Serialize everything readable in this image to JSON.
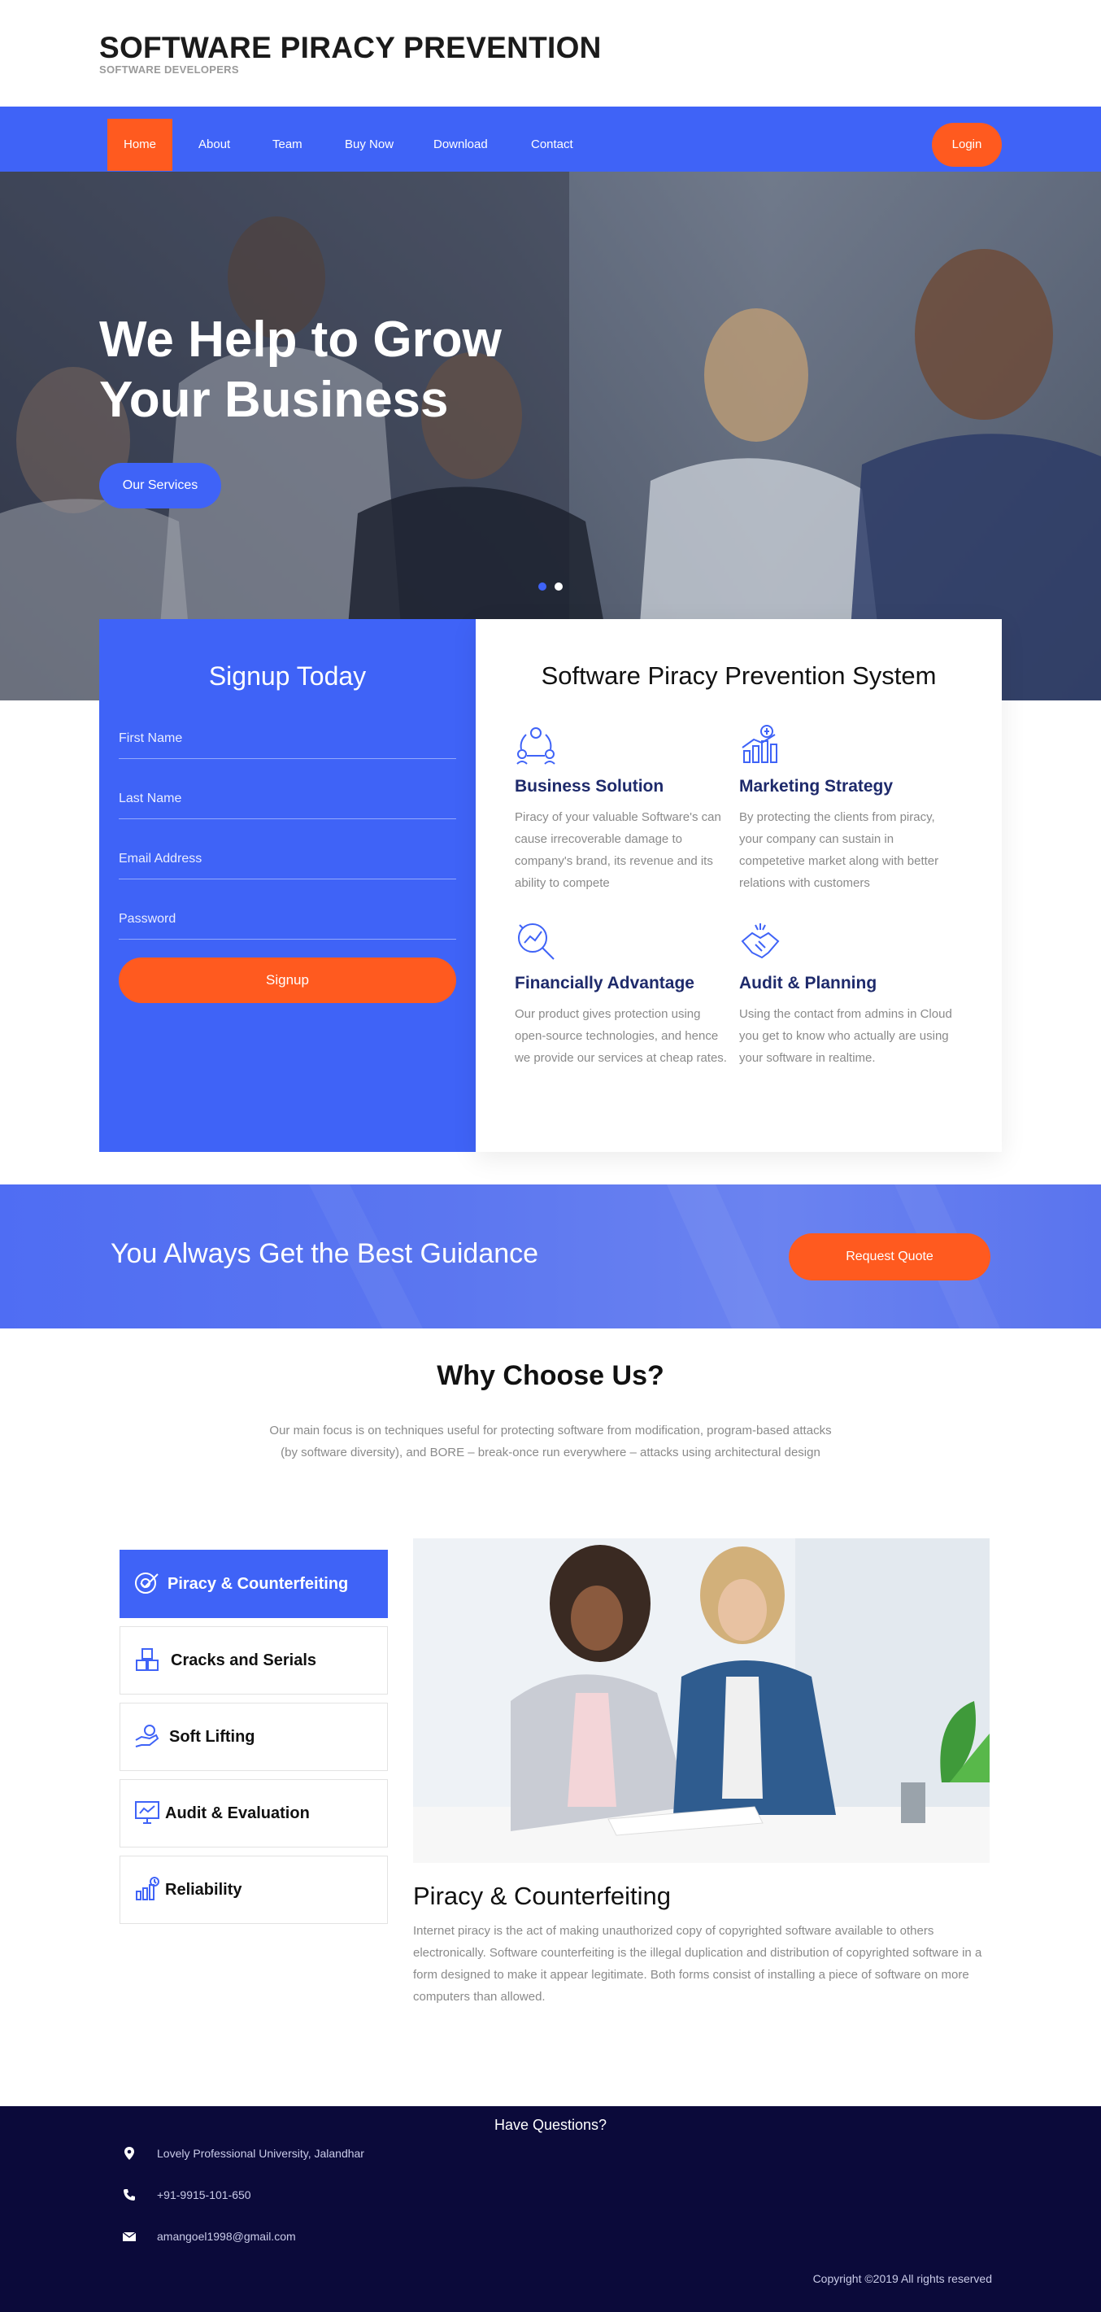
{
  "header": {
    "title": "SOFTWARE PIRACY PREVENTION",
    "subtitle": "SOFTWARE DEVELOPERS"
  },
  "nav": {
    "items": [
      {
        "label": "Home",
        "active": true
      },
      {
        "label": "About"
      },
      {
        "label": "Team"
      },
      {
        "label": "Buy Now"
      },
      {
        "label": "Download"
      },
      {
        "label": "Contact"
      }
    ],
    "login": "Login",
    "colors": {
      "bar": "#3f63f7",
      "accent": "#ff5a1f"
    }
  },
  "hero": {
    "title": "We Help to Grow Your Business",
    "button": "Our Services",
    "slides_total": 2,
    "active_slide": 2
  },
  "signup": {
    "title": "Signup Today",
    "fields": [
      {
        "placeholder": "First Name"
      },
      {
        "placeholder": "Last Name"
      },
      {
        "placeholder": "Email Address"
      },
      {
        "placeholder": "Password"
      }
    ],
    "button": "Signup"
  },
  "system": {
    "title": "Software Piracy Prevention System",
    "features": [
      {
        "icon": "network-people-icon",
        "title": "Business Solution",
        "desc": "Piracy of your valuable Software's can cause irrecoverable damage to company's brand, its revenue and its ability to compete"
      },
      {
        "icon": "growth-chart-icon",
        "title": "Marketing Strategy",
        "desc": "By protecting the clients from piracy, your company can sustain in competetive market along with better relations with customers"
      },
      {
        "icon": "magnifier-chart-icon",
        "title": "Financially Advantage",
        "desc": "Our product gives protection using open-source technologies, and hence we provide our services at cheap rates."
      },
      {
        "icon": "handshake-icon",
        "title": "Audit & Planning",
        "desc": "Using the contact from admins in Cloud you get to know who actually are using your software in realtime."
      }
    ]
  },
  "guidance": {
    "text": "You Always Get the Best Guidance",
    "button": "Request Quote"
  },
  "why": {
    "title": "Why Choose Us?",
    "desc": "Our main focus is on techniques useful for protecting software from modification, program-based attacks (by software diversity), and BORE – break-once run everywhere – attacks using architectural design",
    "tabs": [
      {
        "icon": "target-check-icon",
        "label": "Piracy & Counterfeiting",
        "active": true
      },
      {
        "icon": "boxes-icon",
        "label": "Cracks and Serials"
      },
      {
        "icon": "hand-coin-icon",
        "label": "Soft Lifting"
      },
      {
        "icon": "audit-screen-icon",
        "label": "Audit & Evaluation"
      },
      {
        "icon": "reliability-chart-icon",
        "label": "Reliability"
      }
    ],
    "active_tab": {
      "heading": "Piracy & Counterfeiting",
      "text": "Internet piracy is the act of making unauthorized copy of copyrighted software available to others electronically. Software counterfeiting is the illegal duplication and distribution of copyrighted software in a form designed to make it appear legitimate. Both forms consist of installing a piece of software on more computers than allowed."
    }
  },
  "footer": {
    "title": "Have Questions?",
    "contacts": [
      {
        "icon": "map-pin-icon",
        "text": "Lovely Professional University, Jalandhar"
      },
      {
        "icon": "phone-icon",
        "text": "+91-9915-101-650"
      },
      {
        "icon": "envelope-icon",
        "text": "amangoel1998@gmail.com"
      }
    ],
    "copyright": "Copyright ©2019 All rights reserved"
  }
}
